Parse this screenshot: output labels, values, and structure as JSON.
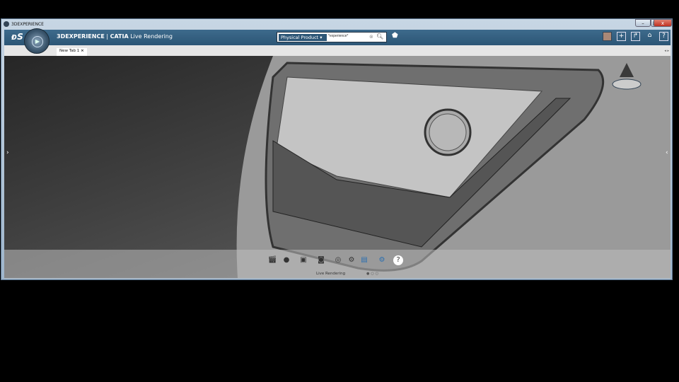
{
  "window": {
    "title": "3DEXPERIENCE",
    "controls": [
      "minimize",
      "maximize",
      "close"
    ]
  },
  "header": {
    "brand": "3DEXPERIENCE",
    "separator": " | ",
    "app": "CATIA",
    "app_suffix": " Live Rendering"
  },
  "search": {
    "type": "Physical Product",
    "value": "*experience*"
  },
  "top_icons": [
    "user-avatar",
    "add-icon",
    "share-icon",
    "home-icon",
    "help-icon"
  ],
  "tabs": [
    {
      "label": "New Tab 1"
    }
  ],
  "action_bar": {
    "label": "Live Rendering",
    "pages": 3,
    "active_page": 1,
    "tools": [
      "clapperboard-icon",
      "environment-icon",
      "image-icon",
      "camera-icon",
      "render-icon",
      "settings-icon",
      "database-icon",
      "gear-doc-icon",
      "help-icon"
    ]
  },
  "colors": {
    "header": "#2c5676",
    "accent": "#2d5676"
  }
}
